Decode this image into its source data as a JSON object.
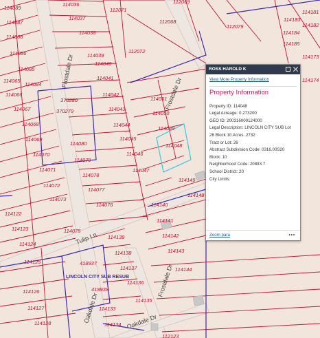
{
  "map": {
    "parcels": [
      "114089",
      "114036",
      "112071",
      "112069",
      "114087",
      "114037",
      "114088",
      "114038",
      "112068",
      "112079",
      "114086",
      "114039",
      "112072",
      "114183",
      "114184",
      "114181",
      "114182",
      "114185",
      "114173",
      "114085",
      "114040",
      "114174",
      "114065",
      "114084",
      "114041",
      "114051",
      "114066",
      "370280",
      "114042",
      "114043",
      "114050",
      "114067",
      "370279",
      "114044",
      "114049",
      "114068",
      "114048",
      "114045",
      "114069",
      "114080",
      "114046",
      "114070",
      "114079",
      "114047",
      "114149",
      "114071",
      "114078",
      "114072",
      "114077",
      "114073",
      "114076",
      "114122",
      "114140",
      "114148",
      "114141",
      "114123",
      "114075",
      "114142",
      "114124",
      "114139",
      "114143",
      "114125",
      "418937",
      "114138",
      "114144",
      "114137",
      "418938",
      "114126",
      "114136",
      "114127",
      "114133",
      "114135",
      "114128",
      "114134",
      "112123"
    ],
    "streets": [
      "Frostdale Dr",
      "Frostdale Dr",
      "Tulip Ln",
      "Oakdale Dr",
      "Oakdale Dr",
      "Frostdale Dr"
    ],
    "subdivision": "LINCOLN CITY SUB RESUB"
  },
  "popup": {
    "owner": "ROSS HAROLD K",
    "link": "View More Property Information",
    "title": "Property Information",
    "rows": [
      {
        "label": "Property ID:",
        "value": "114048"
      },
      {
        "label": "Legal Acreage:",
        "value": "0.273200"
      },
      {
        "label": "GEO ID:",
        "value": "200316000124000"
      },
      {
        "label": "Legal Description:",
        "value": "LINCOLN CITY SUB Lot 26 Block 10 Acres .2732"
      },
      {
        "label": "Tract or Lot:",
        "value": "26"
      },
      {
        "label": "Abstract Subdivision Code:",
        "value": "0316.00S20"
      },
      {
        "label": "Block:",
        "value": "10"
      },
      {
        "label": "Neighborhood Code:",
        "value": "20893.7"
      },
      {
        "label": "School District:",
        "value": "20"
      },
      {
        "label": "City Limits:",
        "value": ""
      }
    ],
    "zoom": "Zoom para",
    "more": "•••"
  }
}
